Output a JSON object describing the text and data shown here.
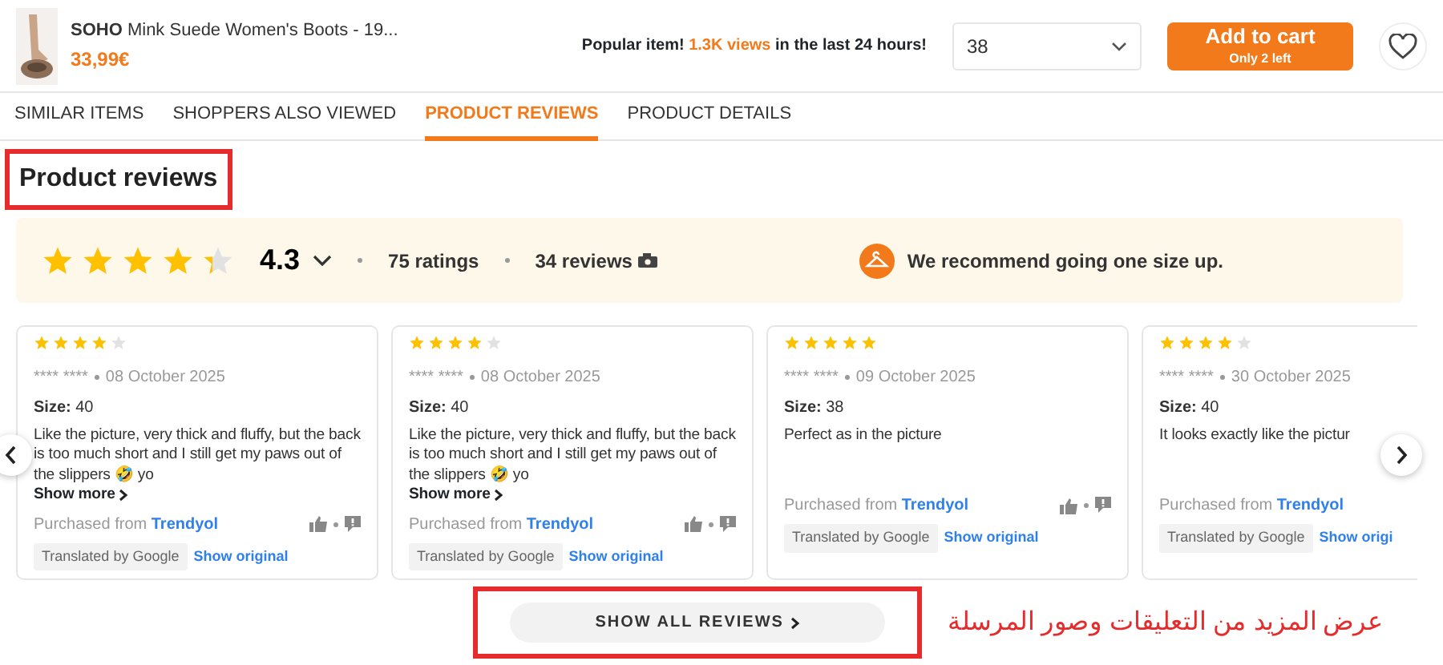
{
  "product": {
    "brand": "SOHO",
    "name": "Mink Suede Women's Boots - 19...",
    "price": "33,99€",
    "popular_parts": [
      {
        "text": "Popular item! ",
        "accent": false
      },
      {
        "text": "1.3K views",
        "accent": true
      },
      {
        "text": " in the last 24 hours!",
        "accent": false
      }
    ],
    "size": "38",
    "cart_button": "Add to cart",
    "stock_note": "Only 2 left"
  },
  "tabs": [
    {
      "label": "SIMILAR ITEMS",
      "selected": false
    },
    {
      "label": "SHOPPERS ALSO VIEWED",
      "selected": false
    },
    {
      "label": "PRODUCT REVIEWS",
      "selected": true
    },
    {
      "label": "PRODUCT DETAILS",
      "selected": false
    }
  ],
  "reviews": {
    "title": "Product reviews",
    "title_highlighted": true,
    "summary": {
      "stars": 4.3,
      "score": "4.3",
      "ratings": "75 ratings",
      "reviews": "34 reviews",
      "fit_note": "We recommend going one size up."
    },
    "cards": [
      {
        "stars": 4,
        "author": "**** ****",
        "date": "08 October 2025",
        "size_label": "Size:",
        "size": "40",
        "text": "Like the picture, very thick and fluffy, but the back is too much short and I still get my paws out of the slippers 🤣 yo",
        "more": "Show more",
        "source_prefix": "Purchased from",
        "source": "Trendyol",
        "votes": true,
        "translated": "Translated by Google",
        "original_link": "Show original"
      },
      {
        "stars": 4,
        "author": "**** ****",
        "date": "08 October 2025",
        "size_label": "Size:",
        "size": "40",
        "text": "Like the picture, very thick and fluffy, but the back is too much short and I still get my paws out of the slippers 🤣 yo",
        "more": "Show more",
        "source_prefix": "Purchased from",
        "source": "Trendyol",
        "votes": true,
        "translated": "Translated by Google",
        "original_link": "Show original"
      },
      {
        "stars": 5,
        "author": "**** ****",
        "date": "09 October 2025",
        "size_label": "Size:",
        "size": "38",
        "text": "Perfect as in the picture",
        "source_prefix": "Purchased from",
        "source": "Trendyol",
        "votes": true,
        "translated": "Translated by Google",
        "original_link": "Show original"
      },
      {
        "stars": 4,
        "author": "**** ****",
        "date": "30 October 2025",
        "size_label": "Size:",
        "size": "40",
        "text": "It looks exactly like the pictur",
        "source_prefix": "Purchased from",
        "source": "Trendyol",
        "translated": "Translated by Google",
        "original_link": "Show origi"
      }
    ],
    "show_all": "SHOW ALL REVIEWS",
    "show_all_highlighted": true,
    "annotation": "عرض المزيد من التعليقات وصور المرسلة"
  }
}
